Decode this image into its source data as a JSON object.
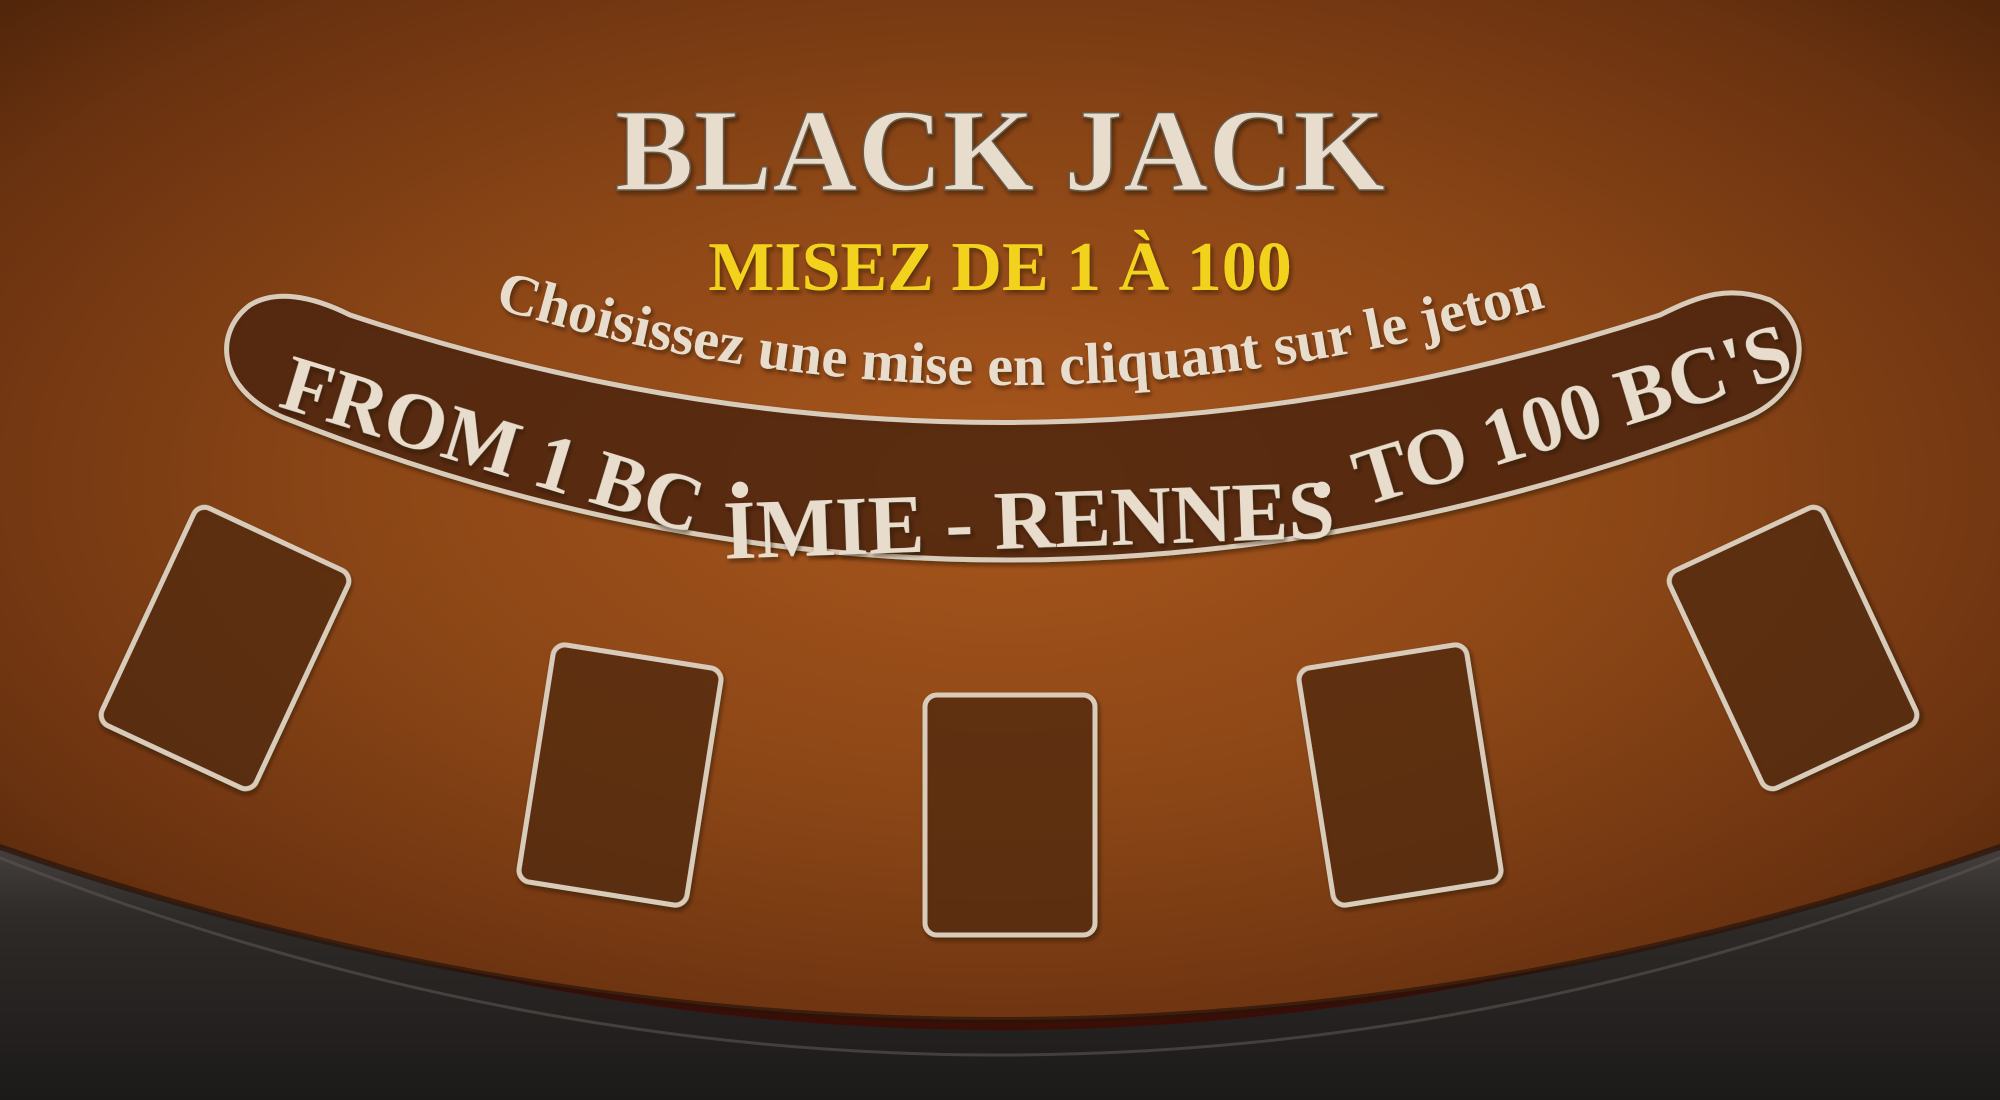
{
  "table": {
    "title": "BLACK JACK",
    "subtitle": "MISEZ DE 1 À 100",
    "instruction": "Choisissez une mise en cliquant sur le jeton",
    "banner_left": "FROM 1 BC",
    "banner_center": "IMIE - RENNES",
    "banner_right": "TO 100 BC'S",
    "separator": "•"
  },
  "card_spots": [
    {
      "id": "spot-1"
    },
    {
      "id": "spot-2"
    },
    {
      "id": "spot-3"
    },
    {
      "id": "spot-4"
    },
    {
      "id": "spot-5"
    }
  ],
  "colors": {
    "felt_center": "#a8561c",
    "felt_mid": "#7e3f14",
    "felt_edge": "#4a2209",
    "chalk": "#e8dccd",
    "subtitle_yellow": "#f2d21a",
    "banner_fill": "#52280f",
    "spot_fill": "#5a2c10",
    "rail": "#2a2624",
    "rail_highlight": "#4a4542",
    "carpet": "#4a1208"
  }
}
